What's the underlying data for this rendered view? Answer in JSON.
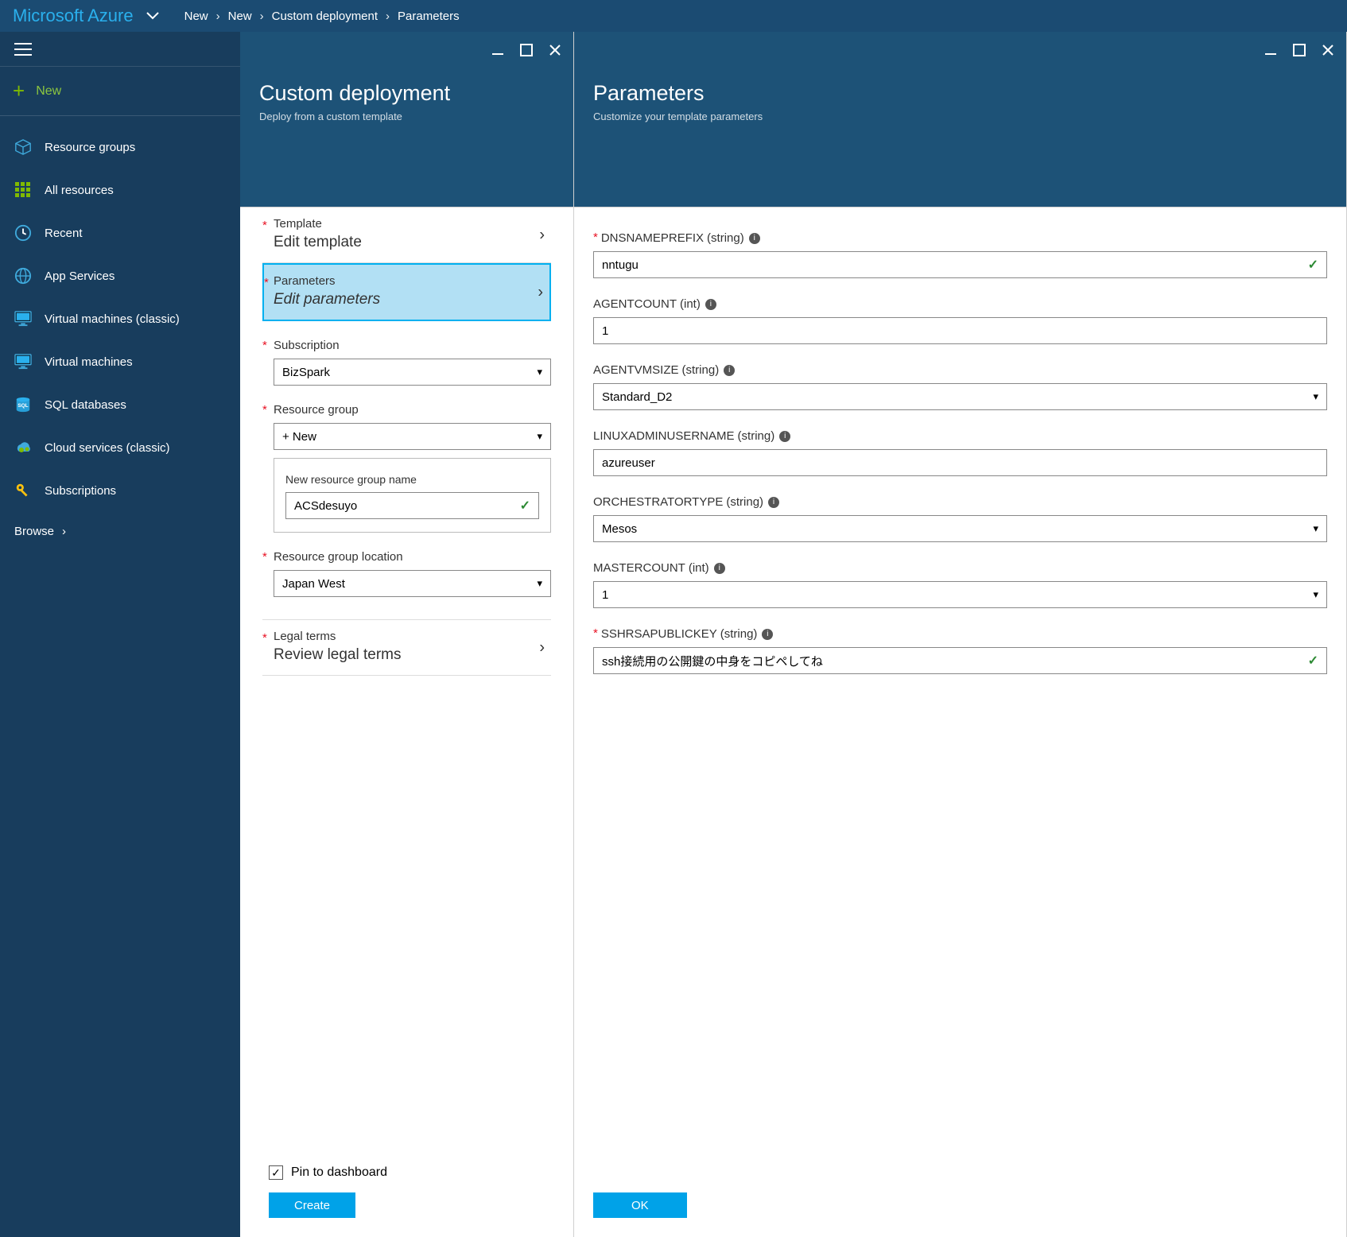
{
  "brand": "Microsoft Azure",
  "breadcrumbs": [
    "New",
    "New",
    "Custom deployment",
    "Parameters"
  ],
  "sidebar": {
    "new_label": "New",
    "items": [
      {
        "label": "Resource groups"
      },
      {
        "label": "All resources"
      },
      {
        "label": "Recent"
      },
      {
        "label": "App Services"
      },
      {
        "label": "Virtual machines (classic)"
      },
      {
        "label": "Virtual machines"
      },
      {
        "label": "SQL databases"
      },
      {
        "label": "Cloud services (classic)"
      },
      {
        "label": "Subscriptions"
      }
    ],
    "browse_label": "Browse"
  },
  "deployment": {
    "title": "Custom deployment",
    "subtitle": "Deploy from a custom template",
    "template": {
      "label": "Template",
      "value": "Edit template"
    },
    "parameters": {
      "label": "Parameters",
      "value": "Edit parameters"
    },
    "subscription": {
      "label": "Subscription",
      "value": "BizSpark"
    },
    "resource_group": {
      "label": "Resource group",
      "value": "+ New"
    },
    "new_rg": {
      "label": "New resource group name",
      "value": "ACSdesuyo"
    },
    "location": {
      "label": "Resource group location",
      "value": "Japan West"
    },
    "legal": {
      "label": "Legal terms",
      "value": "Review legal terms"
    },
    "pin_label": "Pin to dashboard",
    "create_label": "Create"
  },
  "parameters": {
    "title": "Parameters",
    "subtitle": "Customize your template parameters",
    "fields": {
      "dnsnameprefix": {
        "label": "DNSNAMEPREFIX",
        "type": "(string)",
        "value": "nntugu",
        "required": true,
        "kind": "text",
        "valid": true
      },
      "agentcount": {
        "label": "AGENTCOUNT",
        "type": "(int)",
        "value": "1",
        "required": false,
        "kind": "text"
      },
      "agentvmsize": {
        "label": "AGENTVMSIZE",
        "type": "(string)",
        "value": "Standard_D2",
        "required": false,
        "kind": "select"
      },
      "linuxadminusername": {
        "label": "LINUXADMINUSERNAME",
        "type": "(string)",
        "value": "azureuser",
        "required": false,
        "kind": "text"
      },
      "orchestratortype": {
        "label": "ORCHESTRATORTYPE",
        "type": "(string)",
        "value": "Mesos",
        "required": false,
        "kind": "select"
      },
      "mastercount": {
        "label": "MASTERCOUNT",
        "type": "(int)",
        "value": "1",
        "required": false,
        "kind": "select"
      },
      "sshrsapublickey": {
        "label": "SSHRSAPUBLICKEY",
        "type": "(string)",
        "value": "ssh接続用の公開鍵の中身をコピペしてね",
        "required": true,
        "kind": "text",
        "valid": true
      }
    },
    "ok_label": "OK"
  }
}
